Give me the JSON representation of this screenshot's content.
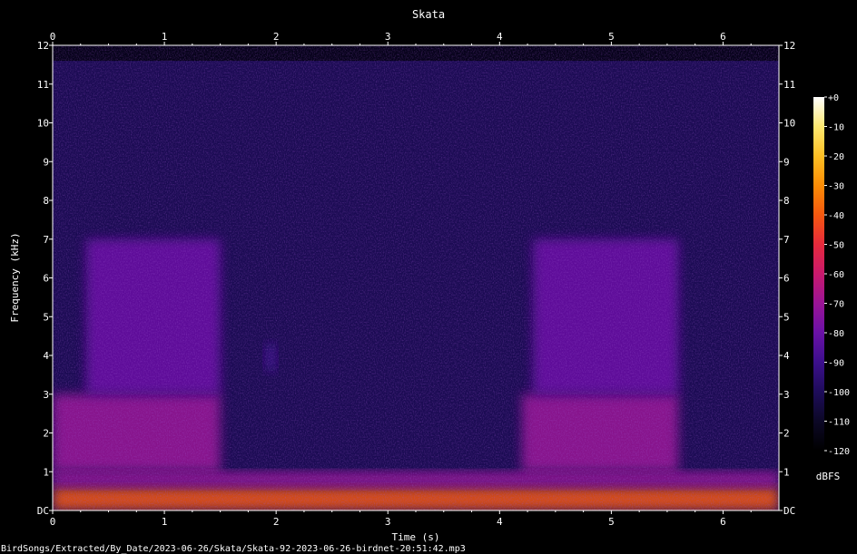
{
  "colors": {
    "background": "#000000",
    "text": "#ffffff",
    "axis": "#ffffff"
  },
  "chart_data": {
    "type": "heatmap",
    "title": "Skata",
    "xlabel": "Time (s)",
    "ylabel": "Frequency (kHz)",
    "xlim": [
      0,
      6.5
    ],
    "ylim": [
      0,
      12
    ],
    "x_ticks": [
      0,
      1,
      2,
      3,
      4,
      5,
      6
    ],
    "y_ticks": [
      {
        "value": 0,
        "label": "DC"
      },
      {
        "value": 1,
        "label": "1"
      },
      {
        "value": 2,
        "label": "2"
      },
      {
        "value": 3,
        "label": "3"
      },
      {
        "value": 4,
        "label": "4"
      },
      {
        "value": 5,
        "label": "5"
      },
      {
        "value": 6,
        "label": "6"
      },
      {
        "value": 7,
        "label": "7"
      },
      {
        "value": 8,
        "label": "8"
      },
      {
        "value": 9,
        "label": "9"
      },
      {
        "value": 10,
        "label": "10"
      },
      {
        "value": 11,
        "label": "11"
      },
      {
        "value": 12,
        "label": "12"
      }
    ],
    "grid": false,
    "signal_max_khz": 11.6,
    "colorbar": {
      "label": "dBFS",
      "range": [
        -120,
        0
      ],
      "ticks": [
        "+0",
        "-10",
        "-20",
        "-30",
        "-40",
        "-50",
        "-60",
        "-70",
        "-80",
        "-90",
        "-100",
        "-110",
        "-120"
      ],
      "colormap": [
        "#000000",
        "#0c0826",
        "#1e0c5a",
        "#3c0f8c",
        "#6a11a6",
        "#9a1496",
        "#c8196c",
        "#e62a3c",
        "#f5580f",
        "#fb8c05",
        "#fdbf24",
        "#fde870",
        "#ffffff"
      ]
    },
    "regions": [
      {
        "t_start": 0.0,
        "t_end": 6.5,
        "f_low": 0.0,
        "f_high": 0.6,
        "level_dbfs": -45
      },
      {
        "t_start": 0.0,
        "t_end": 6.5,
        "f_low": 0.6,
        "f_high": 1.0,
        "level_dbfs": -70
      },
      {
        "t_start": 0.0,
        "t_end": 1.5,
        "f_low": 1.0,
        "f_high": 3.0,
        "level_dbfs": -72
      },
      {
        "t_start": 0.3,
        "t_end": 1.5,
        "f_low": 3.0,
        "f_high": 7.0,
        "level_dbfs": -85
      },
      {
        "t_start": 4.2,
        "t_end": 5.6,
        "f_low": 1.0,
        "f_high": 3.0,
        "level_dbfs": -74
      },
      {
        "t_start": 4.3,
        "t_end": 5.6,
        "f_low": 3.0,
        "f_high": 7.0,
        "level_dbfs": -84
      },
      {
        "t_start": 1.9,
        "t_end": 2.0,
        "f_low": 3.6,
        "f_high": 4.3,
        "level_dbfs": -88
      }
    ]
  },
  "footer": {
    "path": "BirdSongs/Extracted/By_Date/2023-06-26/Skata/Skata-92-2023-06-26-birdnet-20:51:42.mp3"
  }
}
